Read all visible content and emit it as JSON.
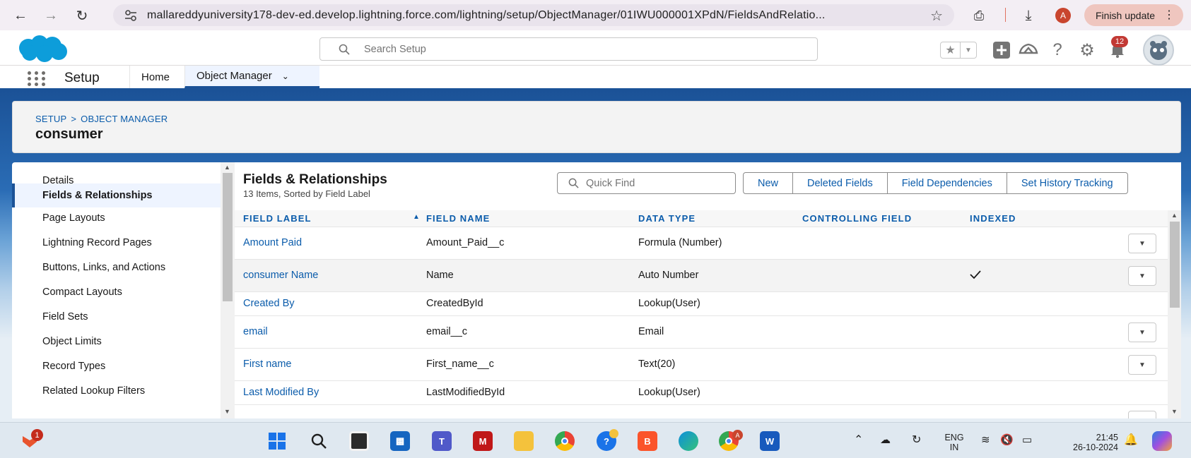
{
  "browser": {
    "url": "mallareddyuniversity178-dev-ed.develop.lightning.force.com/lightning/setup/ObjectManager/01IWU000001XPdN/FieldsAndRelatio...",
    "finish_update_label": "Finish update",
    "profile_initial": "A"
  },
  "header": {
    "search_placeholder": "Search Setup",
    "notification_count": "12"
  },
  "app_nav": {
    "app_name": "Setup",
    "tabs": [
      {
        "label": "Home"
      },
      {
        "label": "Object Manager"
      }
    ]
  },
  "object_header": {
    "breadcrumb": [
      "SETUP",
      ">",
      "OBJECT MANAGER"
    ],
    "title": "consumer"
  },
  "sidebar": {
    "items": [
      {
        "label": "Details"
      },
      {
        "label": "Fields & Relationships"
      },
      {
        "label": "Page Layouts"
      },
      {
        "label": "Lightning Record Pages"
      },
      {
        "label": "Buttons, Links, and Actions"
      },
      {
        "label": "Compact Layouts"
      },
      {
        "label": "Field Sets"
      },
      {
        "label": "Object Limits"
      },
      {
        "label": "Record Types"
      },
      {
        "label": "Related Lookup Filters"
      }
    ],
    "active_item": "Fields & Relationships"
  },
  "main": {
    "title": "Fields & Relationships",
    "subtitle": "13 Items, Sorted by Field Label",
    "quick_find_placeholder": "Quick Find",
    "buttons": [
      "New",
      "Deleted Fields",
      "Field Dependencies",
      "Set History Tracking"
    ],
    "columns": [
      "FIELD LABEL",
      "FIELD NAME",
      "DATA TYPE",
      "CONTROLLING FIELD",
      "INDEXED"
    ],
    "rows": [
      {
        "label": "Amount Paid",
        "name": "Amount_Paid__c",
        "type": "Formula (Number)",
        "controlling": "",
        "indexed": false
      },
      {
        "label": "consumer Name",
        "name": "Name",
        "type": "Auto Number",
        "controlling": "",
        "indexed": true
      },
      {
        "label": "Created By",
        "name": "CreatedById",
        "type": "Lookup(User)",
        "controlling": "",
        "indexed": false
      },
      {
        "label": "email",
        "name": "email__c",
        "type": "Email",
        "controlling": "",
        "indexed": false
      },
      {
        "label": "First name",
        "name": "First_name__c",
        "type": "Text(20)",
        "controlling": "",
        "indexed": false
      },
      {
        "label": "Last Modified By",
        "name": "LastModifiedById",
        "type": "Lookup(User)",
        "controlling": "",
        "indexed": false
      }
    ]
  },
  "taskbar": {
    "language": "ENG",
    "region": "IN",
    "time": "21:45",
    "date": "26-10-2024",
    "mcafee_badge": "1",
    "chrome_profile_badge": "A"
  },
  "colors": {
    "link_blue": "#0b5cab",
    "brand_blue": "#1b5297",
    "notification_red": "#c23934"
  }
}
